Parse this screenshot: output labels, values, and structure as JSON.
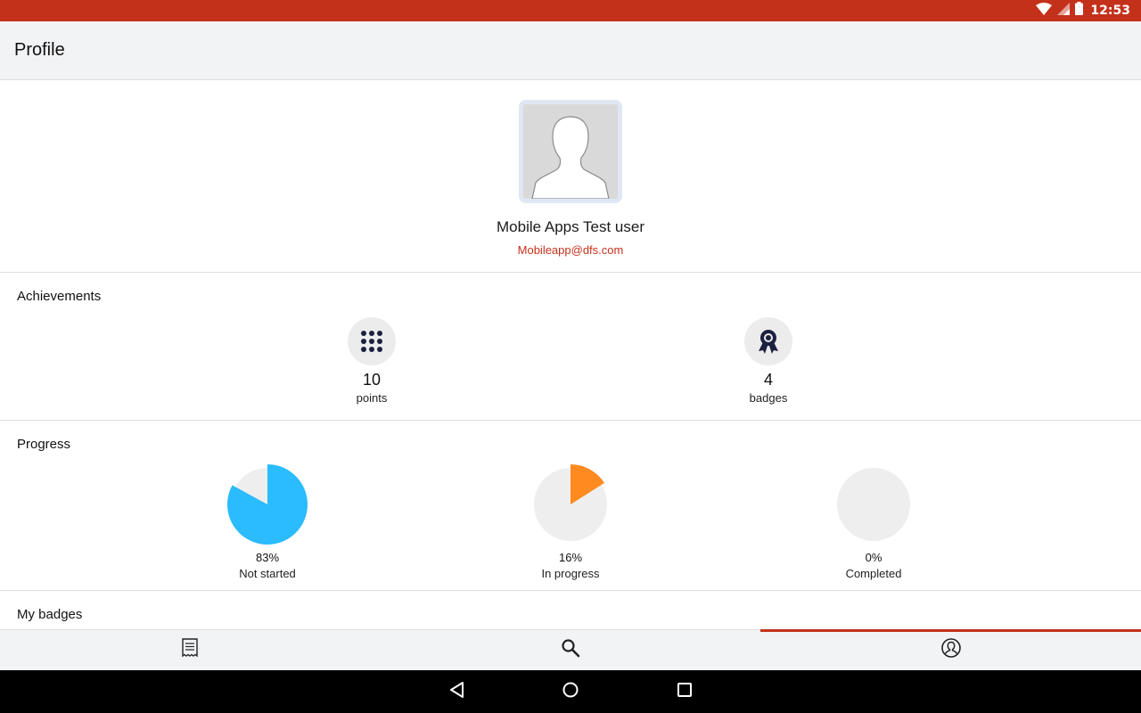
{
  "status_bar": {
    "time": "12:53",
    "icons": [
      "wifi-icon",
      "signal-icon",
      "battery-icon"
    ]
  },
  "app_bar": {
    "title": "Profile"
  },
  "profile": {
    "name": "Mobile Apps Test user",
    "email": "Mobileapp@dfs.com"
  },
  "achievements": {
    "heading": "Achievements",
    "items": [
      {
        "value": "10",
        "label": "points",
        "icon": "points-grid-icon"
      },
      {
        "value": "4",
        "label": "badges",
        "icon": "badge-ribbon-icon"
      }
    ]
  },
  "progress": {
    "heading": "Progress",
    "items": [
      {
        "percent_text": "83%",
        "label": "Not started",
        "fraction": 0.83,
        "color": "#2bbbff"
      },
      {
        "percent_text": "16%",
        "label": "In progress",
        "fraction": 0.16,
        "color": "#ff8a1f"
      },
      {
        "percent_text": "0%",
        "label": "Completed",
        "fraction": 0.0,
        "color": "#9e9e9e"
      }
    ]
  },
  "my_badges": {
    "heading": "My badges"
  },
  "bottom_nav": {
    "tabs": [
      {
        "name": "catalog",
        "icon": "receipt-list-icon",
        "active": false
      },
      {
        "name": "search",
        "icon": "search-icon",
        "active": false
      },
      {
        "name": "profile",
        "icon": "profile-icon",
        "active": true
      }
    ]
  },
  "colors": {
    "accent": "#c4311b",
    "pie_background": "#eeeeee"
  }
}
